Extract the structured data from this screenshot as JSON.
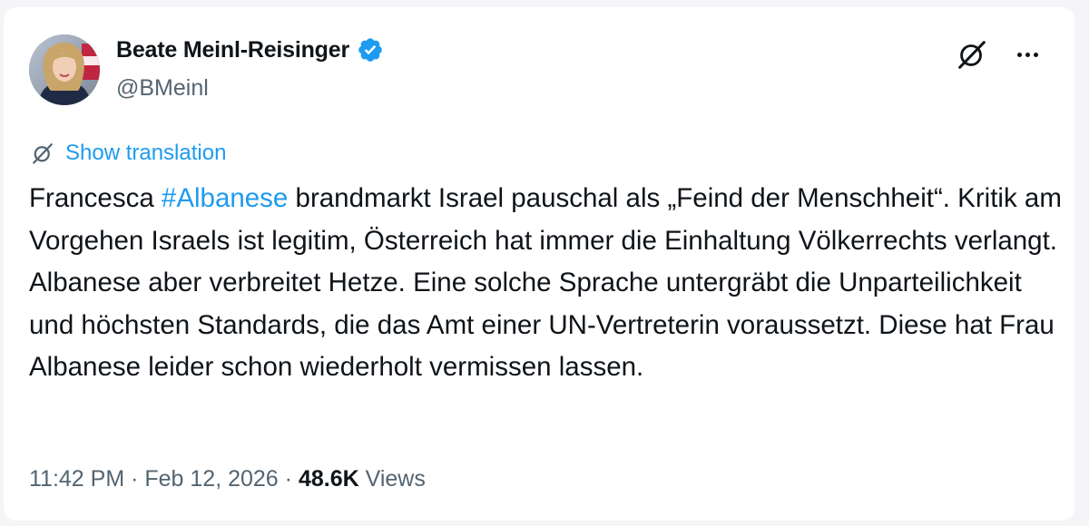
{
  "author": {
    "display_name": "Beate Meinl-Reisinger",
    "handle": "@BMeinl",
    "verified": true,
    "verified_badge_color": "#1d9bf0",
    "avatar_icon": "profile-photo"
  },
  "header_actions": {
    "grok_icon": "grok-icon",
    "more_icon": "more-horizontal-icon"
  },
  "translation": {
    "label": "Show translation",
    "icon": "translate-icon"
  },
  "tweet": {
    "text_before_hashtag": "Francesca ",
    "hashtag": "#Albanese",
    "text_after_hashtag": " brandmarkt Israel pauschal als „Feind der Menschheit“. Kritik am Vorgehen Israels ist legitim, Österreich hat immer die Einhaltung Völkerrechts verlangt. Albanese aber verbreitet Hetze. Eine solche Sprache untergräbt die Unparteilichkeit und höchsten Standards, die das Amt einer UN-Vertreterin voraussetzt. Diese hat Frau Albanese leider schon wiederholt vermissen lassen."
  },
  "meta": {
    "time": "11:42 PM",
    "separator": " · ",
    "date": "Feb 12, 2026",
    "views_count": "48.6K",
    "views_label": "Views"
  },
  "colors": {
    "link": "#1d9bf0",
    "text_primary": "#0f1419",
    "text_secondary": "#536471"
  }
}
